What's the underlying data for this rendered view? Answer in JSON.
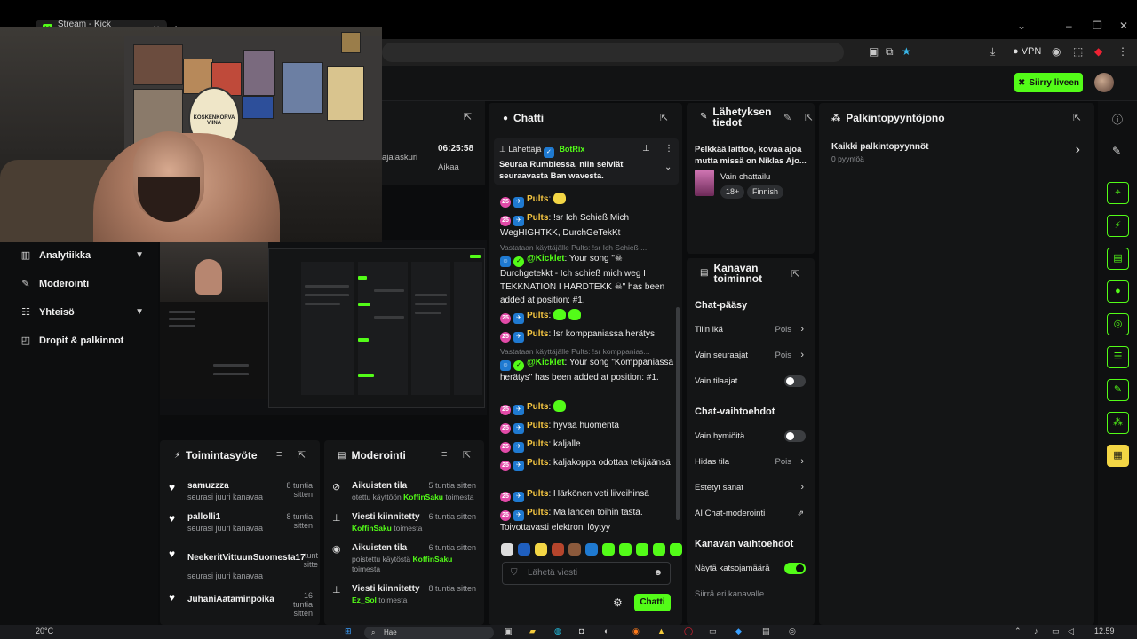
{
  "browser": {
    "tab_title": "Stream - Kick Dashboard",
    "vpn": "VPN"
  },
  "header": {
    "go_live": "Siirry liveen"
  },
  "sidebar": {
    "items": [
      {
        "label": "Analytiikka",
        "expandable": true,
        "icon": "chart-icon"
      },
      {
        "label": "Moderointi",
        "expandable": false,
        "icon": "wrench-icon"
      },
      {
        "label": "Yhteisö",
        "expandable": true,
        "icon": "people-icon"
      },
      {
        "label": "Dropit & palkinnot",
        "expandable": false,
        "icon": "gift-icon"
      }
    ]
  },
  "webcam": {
    "sign_text": "KOSKENKORVA VIINA"
  },
  "stream_preview": {
    "uptime": "06:25:58",
    "uptime_label": "Aikaa",
    "counter_label": "ajalaskuri"
  },
  "activity_feed": {
    "title": "Toimintasyöte",
    "rows": [
      {
        "name": "samuzzza",
        "sub": "seurasi juuri kanavaa",
        "time": "8 tuntia sitten"
      },
      {
        "name": "pallolli1",
        "sub": "seurasi juuri kanavaa",
        "time": "8 tuntia sitten"
      },
      {
        "name": "NeekeritVittuunSuomesta17",
        "sub": "seurasi juuri kanavaa",
        "time": "tunt sitte"
      },
      {
        "name": "JuhaniAataminpoika",
        "sub": "seurasi juuri kanavaa",
        "time": "16 tuntia sitten"
      }
    ]
  },
  "moderation": {
    "title": "Moderointi",
    "rows": [
      {
        "icon": "clock-off-icon",
        "name": "Aikuisten tila",
        "time": "5 tuntia sitten",
        "pre": "otettu käyttöön ",
        "user": "KoffinSaku",
        "post": " toimesta"
      },
      {
        "icon": "pin-icon",
        "name": "Viesti kiinnitetty",
        "time": "6 tuntia sitten",
        "pre": "",
        "user": "KoffinSaku",
        "post": " toimesta"
      },
      {
        "icon": "eye-icon",
        "name": "Aikuisten tila",
        "time": "6 tuntia sitten",
        "pre": "poistettu käytöstä ",
        "user": "KoffinSaku",
        "post": " toimesta"
      },
      {
        "icon": "pin-icon",
        "name": "Viesti kiinnitetty",
        "time": "8 tuntia sitten",
        "pre": "",
        "user": "Ez_Sol",
        "post": " toimesta"
      }
    ]
  },
  "chat": {
    "title": "Chatti",
    "pinned": {
      "label": "Lähettäjä",
      "author": "BotRix",
      "text": "Seuraa Rumblessa, niin selviät seuraavasta Ban wavesta."
    },
    "messages": [
      {
        "user": "Pults",
        "text": ":"
      },
      {
        "user": "Pults",
        "text": ": !sr Ich Schieß Mich WegHIGHTKK, DurchGeTekKt"
      },
      {
        "user": "@Kicklet",
        "reply": "Vastataan käyttäjälle Pults: !sr Ich Schieß ...",
        "text": ": Your song \"☠ Durchgetekkt - Ich schieß mich weg I TEKKNATION I HARDTEKK ☠\" has been added at position: #1."
      },
      {
        "user": "Pults",
        "text": ":"
      },
      {
        "user": "Pults",
        "text": ": !sr komppaniassa herätys"
      },
      {
        "user": "@Kicklet",
        "reply": "Vastataan käyttäjälle Pults: !sr komppanias...",
        "text": ": Your song \"Komppaniassa herätys\" has been added at position: #1."
      },
      {
        "user": "Pults",
        "text": ":"
      },
      {
        "user": "Pults",
        "text": ": hyvää huomenta"
      },
      {
        "user": "Pults",
        "text": ": kaljalle"
      },
      {
        "user": "Pults",
        "text": ": kaljakoppa odottaa tekijäänsä"
      },
      {
        "user": "Pults",
        "text": ": Härkönen veti liiveihinsä"
      },
      {
        "user": "Pults",
        "text": ": Mä lähden töihin tästä. Toivottavasti elektroni löytyy"
      }
    ],
    "input_placeholder": "Lähetä viesti",
    "send_label": "Chatti"
  },
  "stream_info": {
    "title": "Lähetyksen tiedot",
    "description": "Pelkkää laittoo, kovaa ajoa mutta missä on Niklas Ajo...",
    "category": "Vain chattailu",
    "tags": [
      "18+",
      "Finnish"
    ]
  },
  "channel_actions": {
    "title": "Kanavan toiminnot",
    "chat_access_title": "Chat-pääsy",
    "rows_access": [
      {
        "label": "Tilin ikä",
        "value": "Pois",
        "kind": "arrow"
      },
      {
        "label": "Vain seuraajat",
        "value": "Pois",
        "kind": "arrow"
      },
      {
        "label": "Vain tilaajat",
        "value": "",
        "kind": "toggle",
        "on": false
      }
    ],
    "chat_options_title": "Chat-vaihtoehdot",
    "rows_options": [
      {
        "label": "Vain hymiöitä",
        "value": "",
        "kind": "toggle",
        "on": false
      },
      {
        "label": "Hidas tila",
        "value": "Pois",
        "kind": "arrow"
      },
      {
        "label": "Estetyt sanat",
        "value": "",
        "kind": "arrow"
      },
      {
        "label": "AI Chat-moderointi",
        "value": "",
        "kind": "link"
      }
    ],
    "channel_options_title": "Kanavan vaihtoehdot",
    "rows_channel": [
      {
        "label": "Näytä katsojamäärä",
        "value": "",
        "kind": "toggle",
        "on": true
      },
      {
        "label": "Siirrä eri kanavalle",
        "value": "",
        "kind": "none"
      }
    ]
  },
  "rewards": {
    "title": "Palkintopyyntöjono",
    "all_label": "Kaikki palkintopyynnöt",
    "count_label": "0 pyyntöä"
  },
  "taskbar": {
    "weather": "20°C",
    "search": "Hae",
    "time": "12.59"
  }
}
